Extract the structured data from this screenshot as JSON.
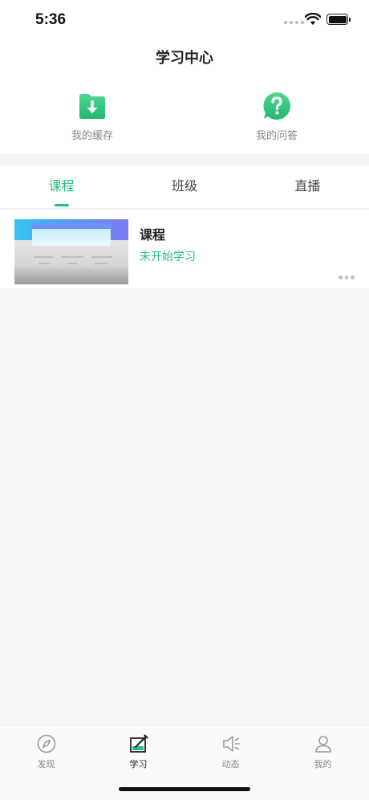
{
  "status_bar": {
    "time": "5:36"
  },
  "nav": {
    "title": "学习中心"
  },
  "quick_actions": [
    {
      "label": "我的缓存",
      "icon": "download-folder-icon"
    },
    {
      "label": "我的问答",
      "icon": "question-bubble-icon"
    }
  ],
  "tabs": [
    {
      "label": "课程",
      "active": true
    },
    {
      "label": "班级",
      "active": false
    },
    {
      "label": "直播",
      "active": false
    }
  ],
  "courses": [
    {
      "title": "课程",
      "status": "未开始学习"
    }
  ],
  "tab_bar": [
    {
      "label": "发现",
      "icon": "compass-icon",
      "active": false
    },
    {
      "label": "学习",
      "icon": "study-icon",
      "active": true
    },
    {
      "label": "动态",
      "icon": "speaker-icon",
      "active": false
    },
    {
      "label": "我的",
      "icon": "person-icon",
      "active": false
    }
  ],
  "colors": {
    "accent": "#23c27b",
    "background": "#f5f5f5"
  }
}
